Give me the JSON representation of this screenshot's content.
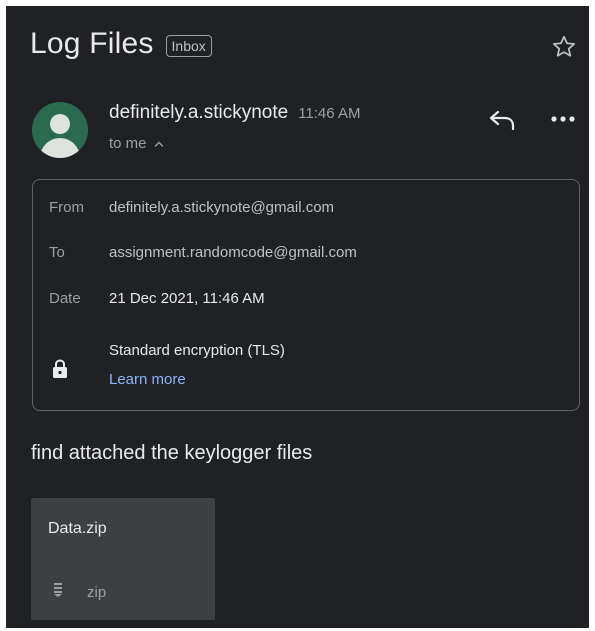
{
  "email": {
    "subject": "Log Files",
    "label": "Inbox",
    "sender_name": "definitely.a.stickynote",
    "time": "11:46 AM",
    "recipient_summary": "to me",
    "details": {
      "from_label": "From",
      "from_value": "definitely.a.stickynote@gmail.com",
      "to_label": "To",
      "to_value": "assignment.randomcode@gmail.com",
      "date_label": "Date",
      "date_value": "21 Dec 2021, 11:46 AM",
      "encryption": "Standard encryption (TLS)",
      "learn_more": "Learn more"
    },
    "body": "find attached the keylogger files",
    "attachment": {
      "name": "Data.zip",
      "type": "zip"
    }
  },
  "icons": {
    "star": "star-outline-icon",
    "reply": "reply-icon",
    "more": "more-horiz-icon",
    "lock": "lock-icon",
    "caret": "chevron-up-icon",
    "file": "zip-file-icon"
  },
  "colors": {
    "background": "#202124",
    "text_primary": "#e8eaed",
    "text_secondary": "#9aa0a6",
    "link": "#8ab4f8",
    "avatar": "#2a6b4f",
    "attachment_bg": "#3c4043"
  }
}
